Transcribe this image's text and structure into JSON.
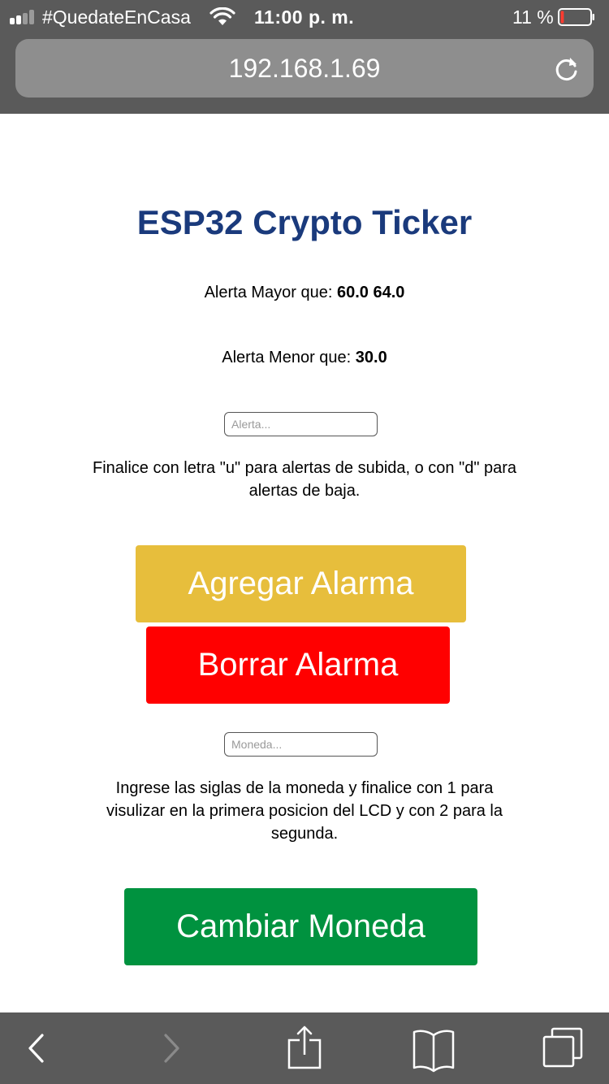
{
  "status_bar": {
    "carrier": "#QuedateEnCasa",
    "time": "11:00 p. m.",
    "battery_percent": "11 %",
    "battery_level": 0.11,
    "battery_color": "#ff3b30",
    "signal_bars": 4,
    "signal_filled": 2,
    "icons": [
      "signal-icon",
      "wifi-icon",
      "battery-icon"
    ]
  },
  "browser": {
    "url": "192.168.1.69",
    "reload_icon": "reload-icon",
    "toolbar_icons": [
      "back-icon",
      "forward-icon",
      "share-icon",
      "bookmarks-icon",
      "tabs-icon"
    ]
  },
  "page": {
    "title": "ESP32 Crypto Ticker",
    "title_color": "#1a3a7c",
    "alert_high_label": "Alerta Mayor que:",
    "alert_high_values": "60.0 64.0",
    "alert_low_label": "Alerta Menor que:",
    "alert_low_value": "30.0",
    "alert_input": {
      "value": "",
      "placeholder": "Alerta..."
    },
    "alert_hint": "Finalice con letra \"u\" para alertas de subida, o con \"d\" para alertas de baja.",
    "add_alarm_label": "Agregar Alarma",
    "add_alarm_color": "#e7be3c",
    "delete_alarm_label": "Borrar Alarma",
    "delete_alarm_color": "#ff0000",
    "coin_input": {
      "value": "",
      "placeholder": "Moneda..."
    },
    "coin_hint": "Ingrese las siglas de la moneda y finalice con 1 para visulizar en la primera posicion del LCD y con 2 para la segunda.",
    "change_coin_label": "Cambiar Moneda",
    "change_coin_color": "#00923f"
  }
}
